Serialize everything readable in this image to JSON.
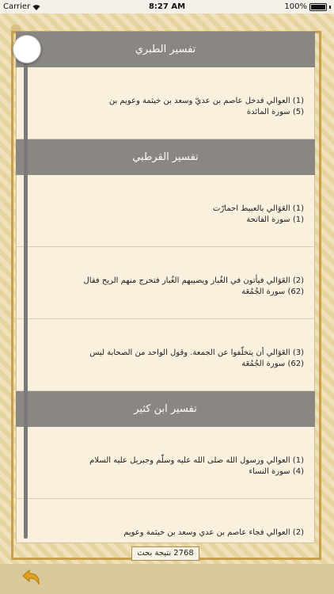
{
  "status_bar": {
    "carrier": "Carrier",
    "time": "8:27 AM",
    "battery": "100%"
  },
  "sections": [
    {
      "title": "تفسير الطبري",
      "results": [
        {
          "line1": "(1)  العوالي فدخل عاصم بن عديّ وسعد بن خيثمة وعويم بن",
          "line2": "(5)  سورة المائدة"
        }
      ]
    },
    {
      "title": "تفسير القرطبي",
      "results": [
        {
          "line1": "(1)  العَوَالي بالعبيط احمارّت",
          "line2": "(1)  سورة الفاتحة"
        },
        {
          "line1": "(2)  العَوَالي فيأتون في الغُبار ويصيبهم الغُبار فتخرج منهم الريح فقال",
          "line2": "(62)  سورة الجُمُعَة"
        },
        {
          "line1": "(3)  العَوَالي أن يتخلّفوا عن الجمعة. وقول الواحد من الصحابة ليس",
          "line2": "(62)  سورة الجُمُعَة"
        }
      ]
    },
    {
      "title": "تفسير ابن كثير",
      "results": [
        {
          "line1": "(1)  العوالي ورسول الله صلى الله عليه وسلّم وجبريل عليه السلام",
          "line2": "(4)  سورة النساء"
        },
        {
          "line1": "(2)  العوالي فجاء عاصم بن عدي وسعد بن خيثمة وعويم",
          "line2": ""
        }
      ]
    }
  ],
  "result_count": "2768 نتيجة بحث",
  "icons": {
    "back": "back-arrow-icon",
    "wifi": "wifi-icon",
    "battery": "battery-icon"
  },
  "colors": {
    "header_bg": "#8a8783",
    "frame_gold": "#c9a04e",
    "back_arrow": "#e0a21c"
  }
}
